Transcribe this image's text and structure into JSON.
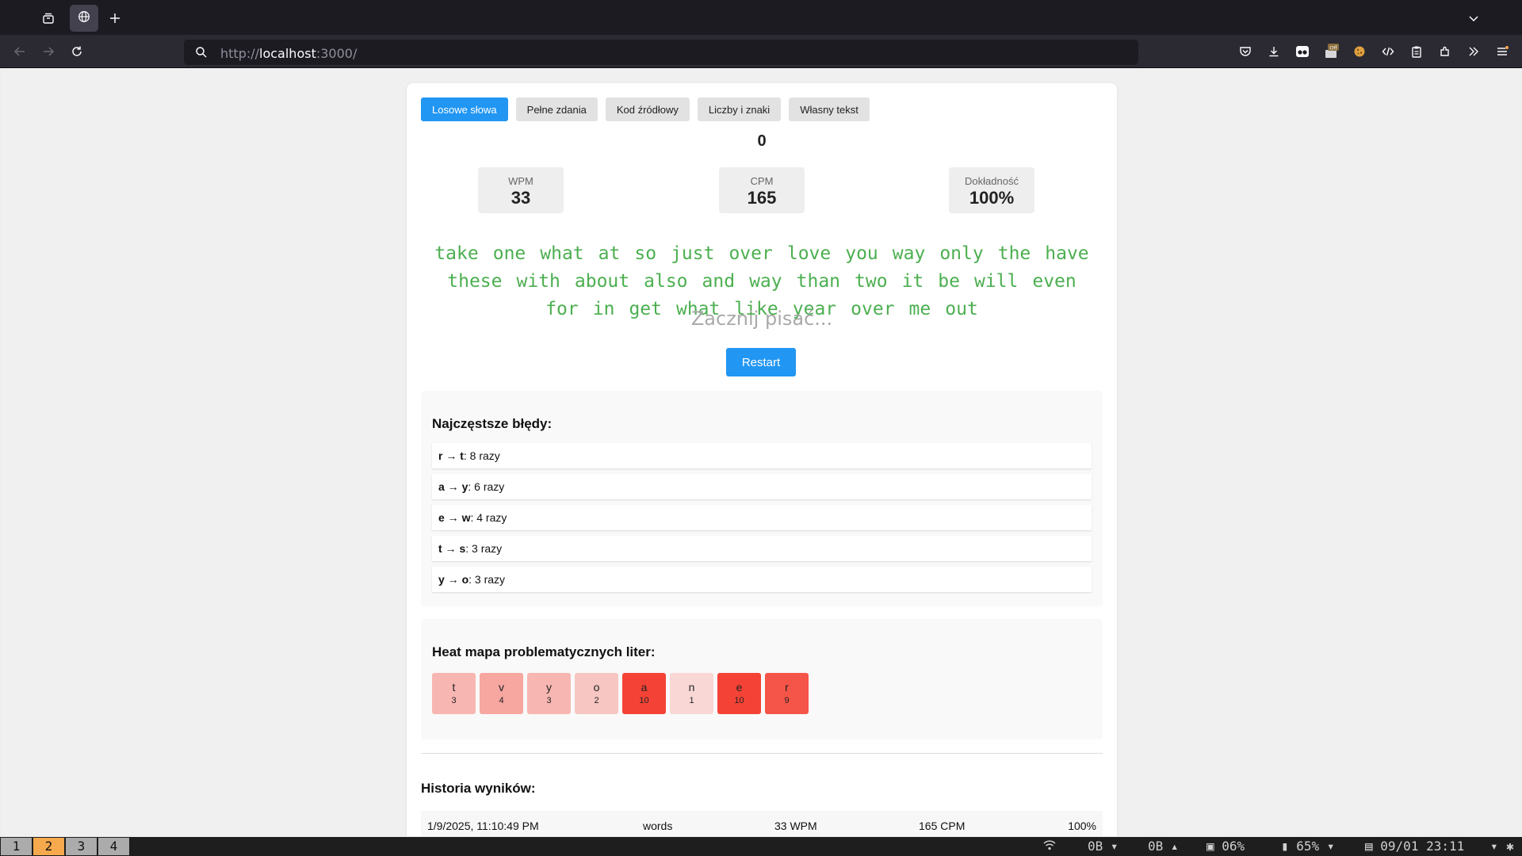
{
  "browser": {
    "url_scheme": "http://",
    "url_host": "localhost",
    "url_rest": ":3000/"
  },
  "modes": [
    "Losowe słowa",
    "Pełne zdania",
    "Kod źródłowy",
    "Liczby i znaki",
    "Własny tekst"
  ],
  "counter": "0",
  "stats": {
    "wpm_label": "WPM",
    "wpm_value": "33",
    "cpm_label": "CPM",
    "cpm_value": "165",
    "acc_label": "Dokładność",
    "acc_value": "100%"
  },
  "words": [
    "take",
    "one",
    "what",
    "at",
    "so",
    "just",
    "over",
    "love",
    "you",
    "way",
    "only",
    "the",
    "have",
    "these",
    "with",
    "about",
    "also",
    "and",
    "way",
    "than",
    "two",
    "it",
    "be",
    "will",
    "even",
    "for",
    "in",
    "get",
    "what",
    "like",
    "year",
    "over",
    "me",
    "out"
  ],
  "input_placeholder": "Zacznij pisać...",
  "restart_label": "Restart",
  "errors": {
    "title": "Najczęstsze błędy:",
    "items": [
      {
        "from": "r",
        "to": "t",
        "count": ": 8 razy"
      },
      {
        "from": "a",
        "to": "y",
        "count": ": 6 razy"
      },
      {
        "from": "e",
        "to": "w",
        "count": ": 4 razy"
      },
      {
        "from": "t",
        "to": "s",
        "count": ": 3 razy"
      },
      {
        "from": "y",
        "to": "o",
        "count": ": 3 razy"
      }
    ]
  },
  "heatmap": {
    "title": "Heat mapa problematycznych liter:",
    "cells": [
      {
        "letter": "t",
        "count": "3"
      },
      {
        "letter": "v",
        "count": "4"
      },
      {
        "letter": "y",
        "count": "3"
      },
      {
        "letter": "o",
        "count": "2"
      },
      {
        "letter": "a",
        "count": "10"
      },
      {
        "letter": "n",
        "count": "1"
      },
      {
        "letter": "e",
        "count": "10"
      },
      {
        "letter": "r",
        "count": "9"
      }
    ]
  },
  "history": {
    "title": "Historia wyników:",
    "rows": [
      {
        "date": "1/9/2025, 11:10:49 PM",
        "mode": "words",
        "wpm": "33 WPM",
        "cpm": "165 CPM",
        "acc": "100%"
      }
    ]
  },
  "statusbar": {
    "workspaces": [
      "1",
      "2",
      "3",
      "4"
    ],
    "active_workspace": "2",
    "net_down": "0B",
    "net_up": "0B",
    "cpu": "06%",
    "battery": "65%",
    "datetime": "09/01 23:11"
  },
  "colors": {
    "accent": "#2196f3",
    "words": "#4caf50",
    "heat_base": "#f44336"
  }
}
